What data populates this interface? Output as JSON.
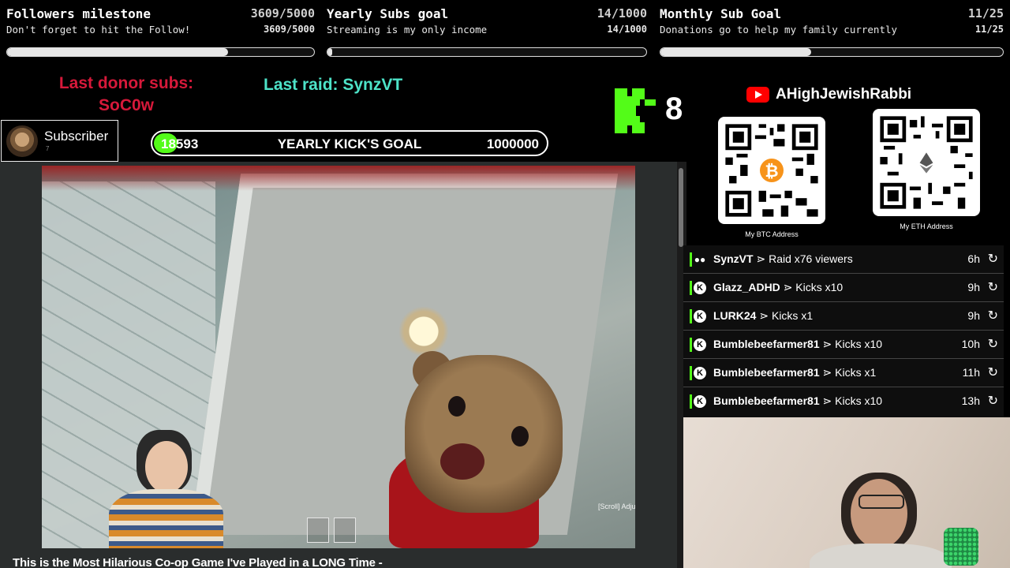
{
  "goals": [
    {
      "title": "Followers milestone",
      "count": "3609/5000",
      "subtitle": "Don't forget to hit the Follow!",
      "progress": 0.72
    },
    {
      "title": "Yearly Subs goal",
      "count": "14/1000",
      "subtitle": "Streaming is my only income",
      "progress": 0.014
    },
    {
      "title": "Monthly Sub Goal",
      "count": "11/25",
      "subtitle": "Donations go to help my family currently",
      "progress": 0.44
    }
  ],
  "donor": {
    "label": "Last donor subs:",
    "name": "SoC0w"
  },
  "raid": {
    "label": "Last raid: SynzVT"
  },
  "subscriber": {
    "label": "Subscriber",
    "count": "7"
  },
  "kick_goal": {
    "current": "18593",
    "title": "YEARLY KICK'S GOAL",
    "target": "1000000",
    "progress": 0.0186
  },
  "kick": {
    "count": "8",
    "accent": "#53fc18"
  },
  "youtube": {
    "channel": "AHighJewishRabbi"
  },
  "qr": {
    "btc_label": "My BTC Address",
    "eth_label": "My ETH Address"
  },
  "events": [
    {
      "icon": "raid-icon",
      "user": "SynzVT",
      "action": "⋗ Raid x76 viewers",
      "time": "6h"
    },
    {
      "icon": "kick-icon",
      "user": "Glazz_ADHD",
      "action": "⋗ Kicks x10",
      "time": "9h"
    },
    {
      "icon": "kick-icon",
      "user": "LURK24",
      "action": "⋗ Kicks x1",
      "time": "9h"
    },
    {
      "icon": "kick-icon",
      "user": "Bumblebeefarmer81",
      "action": "⋗ Kicks x10",
      "time": "10h"
    },
    {
      "icon": "kick-icon",
      "user": "Bumblebeefarmer81",
      "action": "⋗ Kicks x1",
      "time": "11h"
    },
    {
      "icon": "kick-icon",
      "user": "Bumblebeefarmer81",
      "action": "⋗ Kicks x10",
      "time": "13h"
    }
  ],
  "video": {
    "title": "This is the Most Hilarious Co-op Game I've Played in a LONG Time -",
    "overlay_text": "[Scroll] Adjust range"
  }
}
